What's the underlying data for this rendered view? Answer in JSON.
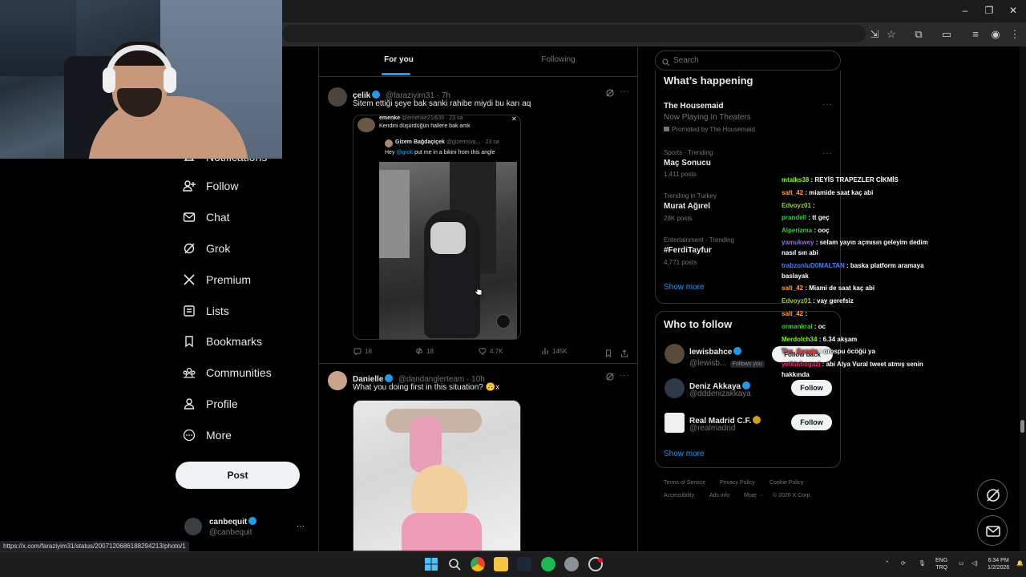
{
  "statusbar_url": "https://x.com/faraziyim31/status/2007120686188294213/photo/1",
  "nav": {
    "items": [
      {
        "label": "Notifications"
      },
      {
        "label": "Follow"
      },
      {
        "label": "Chat"
      },
      {
        "label": "Grok"
      },
      {
        "label": "Premium"
      },
      {
        "label": "Lists"
      },
      {
        "label": "Bookmarks"
      },
      {
        "label": "Communities"
      },
      {
        "label": "Profile"
      },
      {
        "label": "More"
      }
    ],
    "post_label": "Post",
    "account": {
      "name": "canbequit",
      "handle": "@canbequit",
      "more": "···"
    }
  },
  "feed": {
    "tabs": [
      {
        "label": "For you"
      },
      {
        "label": "Following"
      }
    ],
    "tweets": [
      {
        "name": "çelik",
        "handle": "@faraziyim31 · 7h",
        "text": "Sitem ettiği şeye bak sanki rahibe miydi bu karı aq",
        "quote": {
          "name": "emenke",
          "handle": "@emenke21i639 · 23 sa",
          "text": "Kendini düşürdüğün hallere bak amk",
          "inner_name": "Gizem Bağdaçiçek",
          "inner_handle": "@gizemsva... · 23 sa",
          "inner_text_pre": "Hey ",
          "inner_mention": "@grok",
          "inner_text_post": " put me in a bikini from this angle"
        },
        "replies": "18",
        "retweets": "18",
        "likes": "4.7K",
        "views": "145K"
      },
      {
        "name": "Danielle",
        "handle": "@dandanglerteam · 10h",
        "text": "What you doing first in this situation? 🙃x"
      }
    ]
  },
  "right": {
    "search_placeholder": "Search",
    "happening_title": "What’s happening",
    "trends": [
      {
        "meta": "",
        "title": "The Housemaid",
        "sub": "Now Playing In Theaters",
        "promo": "Promoted by The Housemaid"
      },
      {
        "meta": "Sports · Trending",
        "title": "Maç Sonucu",
        "sub": "1,411 posts"
      },
      {
        "meta": "Trending in Turkey",
        "title": "Murat Ağırel",
        "sub": "28K posts"
      },
      {
        "meta": "Entertainment · Trending",
        "title": "#FerdiTayfur",
        "sub": "4,771 posts"
      }
    ],
    "show_more": "Show more",
    "who_title": "Who to follow",
    "who": [
      {
        "name": "lewisbahce",
        "handle": "@lewisb...",
        "badge": "Follows you",
        "button": "Follow back"
      },
      {
        "name": "Deniz Akkaya",
        "handle": "@dddenizakkaya",
        "button": "Follow"
      },
      {
        "name": "Real Madrid C.F.",
        "handle": "@realmadrid",
        "button": "Follow"
      }
    ],
    "who_show_more": "Show more",
    "footer": [
      "Terms of Service",
      "Privacy Policy",
      "Cookie Policy",
      "Accessibility",
      "Ads info",
      "More ···",
      "© 2026 X Corp."
    ]
  },
  "chat": [
    {
      "user": "mtalks38",
      "msg": " : REYİS TRAPEZLER CİKMİS",
      "color": "#7cfc00"
    },
    {
      "user": "salt_42",
      "msg": " : miamide saat kaç abi",
      "color": "#ff9f40"
    },
    {
      "user": "Edvoyz01",
      "msg": " : ",
      "color": "#9acd32"
    },
    {
      "user": "prandell",
      "msg": " : tt geç",
      "color": "#32cd32"
    },
    {
      "user": "Alperizma",
      "msg": " : ooç",
      "color": "#32cd32"
    },
    {
      "user": "yamukwey",
      "msg": " : selam yayın açmısın geleyim dedim nasıl sın abi",
      "color": "#9370db"
    },
    {
      "user": "trabzonluD0MALTAN",
      "msg": " : baska platform aramaya baslayak",
      "color": "#4682ff"
    },
    {
      "user": "salt_42",
      "msg": " : Miami de saat kaç abi",
      "color": "#ff9f40"
    },
    {
      "user": "Edvoyz01",
      "msg": " : vay gerefsiz",
      "color": "#9acd32"
    },
    {
      "user": "salt_42",
      "msg": " : ",
      "color": "#ff9f40"
    },
    {
      "user": "ormankral",
      "msg": " : oc",
      "color": "#32cd32"
    },
    {
      "user": "Merdolch34",
      "msg": " : 6.34 akşam",
      "color": "#7cfc00"
    },
    {
      "user": "The_Gezgin",
      "msg": " : orospu öcöğü ya",
      "color": "#ff4040"
    },
    {
      "user": "yetkinbogazi",
      "msg": " : abi Alya Vural tweet atmış senin hakkında",
      "color": "#ff2080"
    }
  ],
  "taskbar": {
    "lang1": "ENG",
    "lang2": "TRQ",
    "time": "6:34 PM",
    "date": "1/2/2026"
  },
  "colors": {
    "accent": "#1d9bf0",
    "bg": "#000000",
    "border": "#2f3336",
    "muted": "#71767b"
  }
}
